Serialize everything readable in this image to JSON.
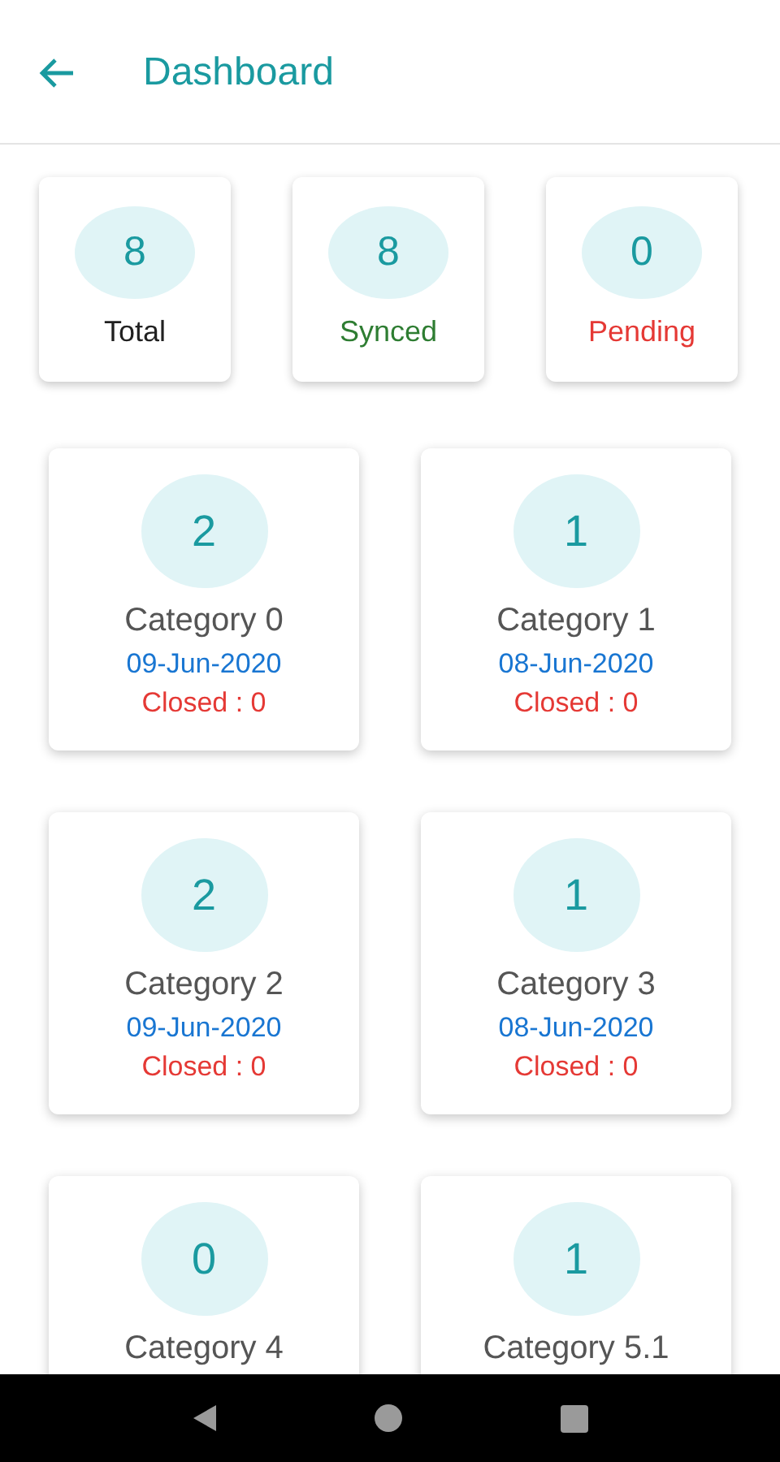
{
  "header": {
    "title": "Dashboard"
  },
  "stats": [
    {
      "count": "8",
      "label": "Total",
      "color": "#212121"
    },
    {
      "count": "8",
      "label": "Synced",
      "color": "#2e7d32"
    },
    {
      "count": "0",
      "label": "Pending",
      "color": "#e53935"
    }
  ],
  "categories": [
    {
      "count": "2",
      "name": "Category 0",
      "date": "09-Jun-2020",
      "closed": "Closed : 0"
    },
    {
      "count": "1",
      "name": "Category 1",
      "date": "08-Jun-2020",
      "closed": "Closed : 0"
    },
    {
      "count": "2",
      "name": "Category 2",
      "date": "09-Jun-2020",
      "closed": "Closed : 0"
    },
    {
      "count": "1",
      "name": "Category 3",
      "date": "08-Jun-2020",
      "closed": "Closed : 0"
    },
    {
      "count": "0",
      "name": "Category 4"
    },
    {
      "count": "1",
      "name": "Category 5.1"
    }
  ]
}
